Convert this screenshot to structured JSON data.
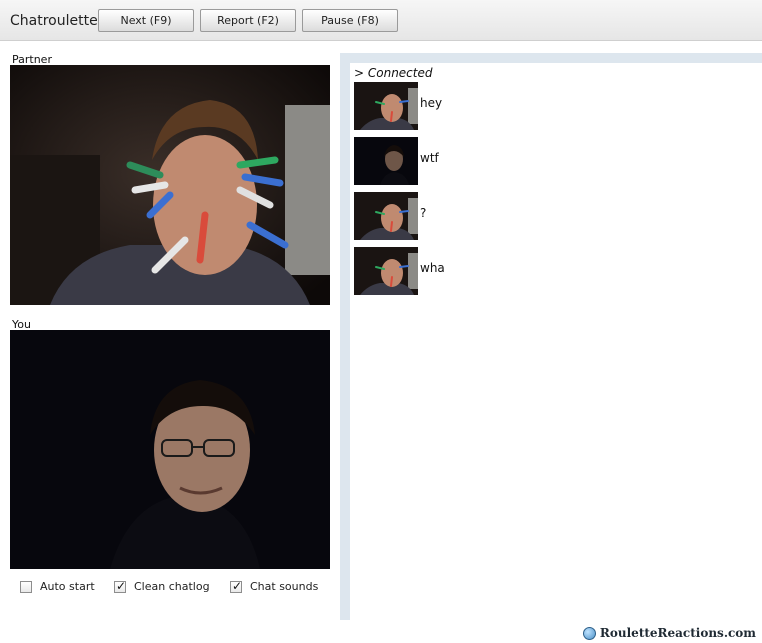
{
  "app": {
    "title": "Chatroulette"
  },
  "toolbar": {
    "next_label": "Next (F9)",
    "report_label": "Report (F2)",
    "pause_label": "Pause (F8)"
  },
  "video": {
    "partner_label": "Partner",
    "you_label": "You"
  },
  "options": {
    "auto_start": {
      "label": "Auto start",
      "checked": false
    },
    "clean_chatlog": {
      "label": "Clean chatlog",
      "checked": true
    },
    "chat_sounds": {
      "label": "Chat sounds",
      "checked": true
    }
  },
  "chat": {
    "status": "> Connected",
    "messages": [
      {
        "text": "hey"
      },
      {
        "text": "wtf"
      },
      {
        "text": "?"
      },
      {
        "text": "wha"
      }
    ]
  },
  "watermark": {
    "text": "RouletteReactions.com"
  },
  "colors": {
    "chat_frame": "#dde6ee",
    "toolbar_bg": "#e6e6e6",
    "video_bg": "#0b0b14"
  }
}
